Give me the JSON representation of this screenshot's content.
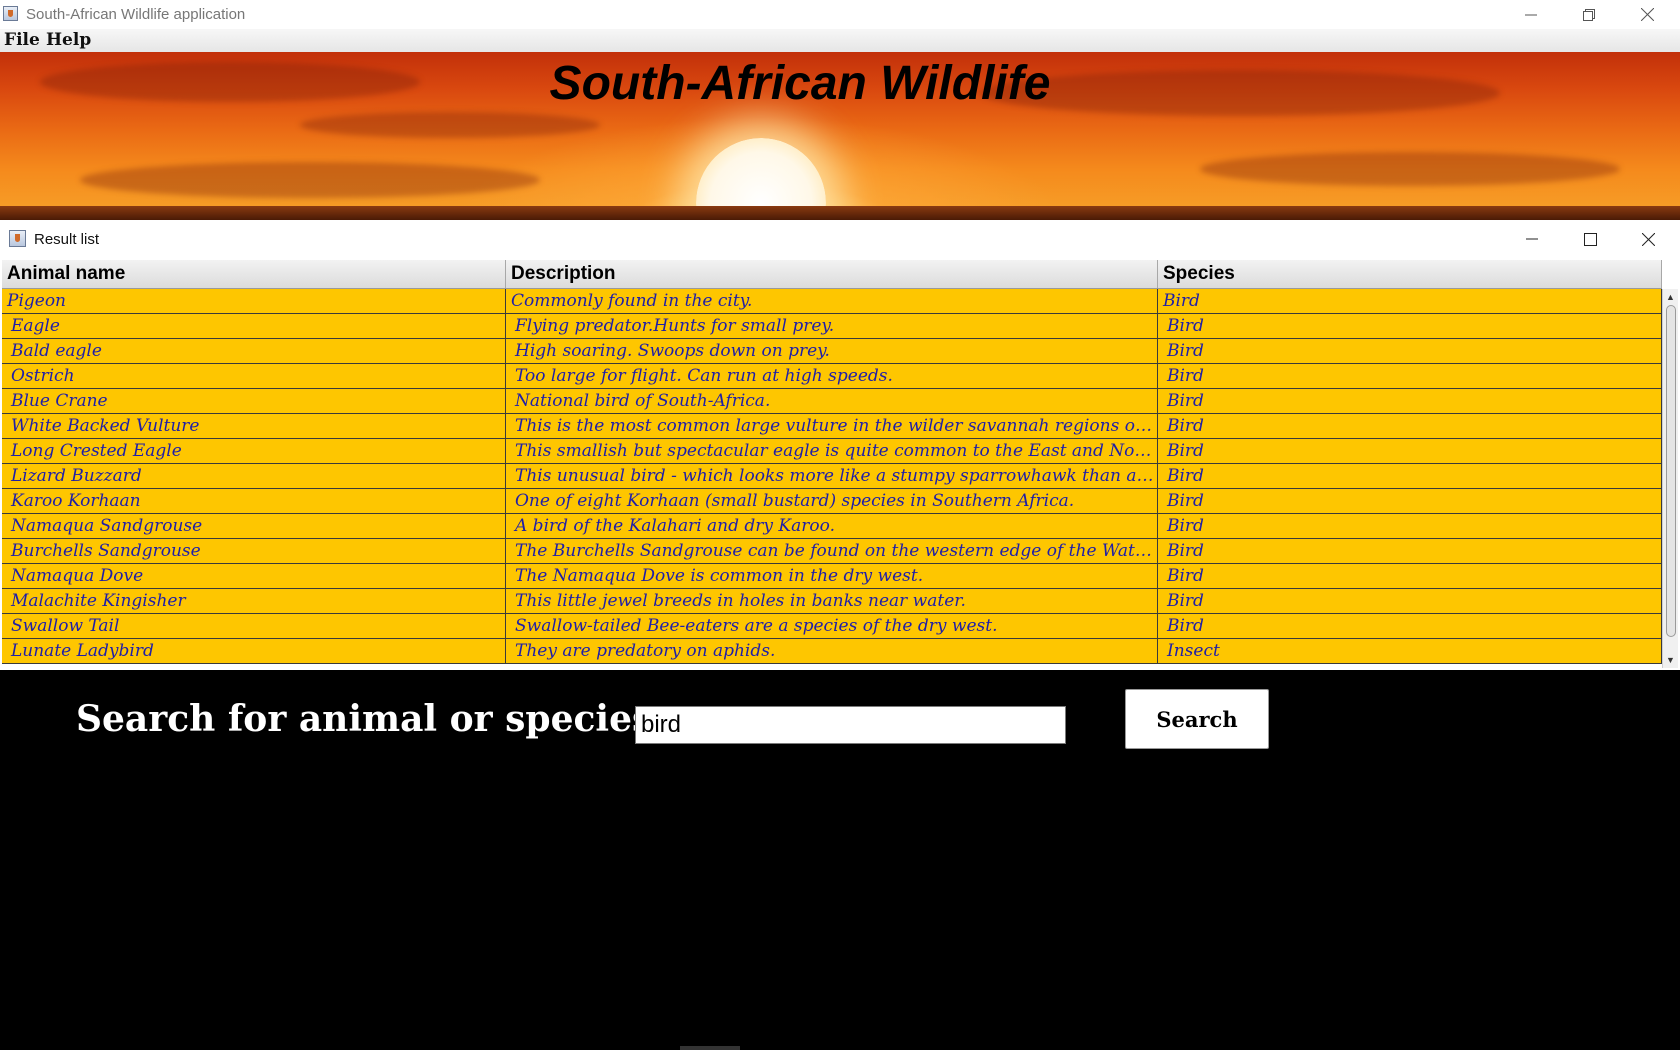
{
  "window": {
    "title": "South-African Wildlife application"
  },
  "menu": {
    "items": [
      "File",
      "Help"
    ]
  },
  "banner": {
    "title": "South-African Wildlife"
  },
  "result_frame": {
    "title": "Result list"
  },
  "table": {
    "columns": [
      "Animal name",
      "Description",
      "Species"
    ],
    "rows": [
      [
        "Pigeon",
        "Commonly found in the city.",
        "Bird"
      ],
      [
        "Eagle",
        "Flying predator.Hunts for small prey.",
        "Bird"
      ],
      [
        "Bald eagle",
        "High soaring. Swoops down on prey.",
        "Bird"
      ],
      [
        "Ostrich",
        "Too large for flight. Can run at high speeds.",
        "Bird"
      ],
      [
        "Blue Crane",
        "National bird of South-Africa.",
        "Bird"
      ],
      [
        "White Backed Vulture",
        "This is the most common large vulture in the wilder savannah regions of Sout...",
        "Bird"
      ],
      [
        "Long Crested Eagle",
        "This smallish but spectacular eagle is quite common to the East and North of t...",
        "Bird"
      ],
      [
        "Lizard Buzzard",
        "This unusual bird - which looks more like a stumpy sparrowhawk than a buzz...",
        "Bird"
      ],
      [
        "Karoo Korhaan",
        "One of eight Korhaan (small bustard) species in Southern Africa.",
        "Bird"
      ],
      [
        "Namaqua Sandgrouse",
        "A bird of the Kalahari and dry Karoo.",
        "Bird"
      ],
      [
        "Burchells Sandgrouse",
        "The Burchells Sandgrouse can be found on the western edge of the Waterberg r...",
        "Bird"
      ],
      [
        "Namaqua Dove",
        "The Namaqua Dove is common in the dry west.",
        "Bird"
      ],
      [
        "Malachite Kingisher",
        "This little jewel breeds in holes in banks near water.",
        "Bird"
      ],
      [
        "Swallow Tail",
        "Swallow-tailed Bee-eaters are a species of the dry west.",
        "Bird"
      ],
      [
        "Lunate Ladybird",
        "They are predatory on aphids.",
        "Insect"
      ]
    ]
  },
  "search": {
    "label": "Search for animal or species :",
    "value": "bird",
    "button_label": "Search"
  },
  "colors": {
    "row_background": "#fec600",
    "row_text": "#1f1fa8",
    "app_background": "#000000"
  },
  "icons": [
    "java-app-icon",
    "minimize-icon",
    "restore-icon",
    "close-icon",
    "maximize-icon",
    "scroll-up-icon",
    "scroll-down-icon"
  ]
}
